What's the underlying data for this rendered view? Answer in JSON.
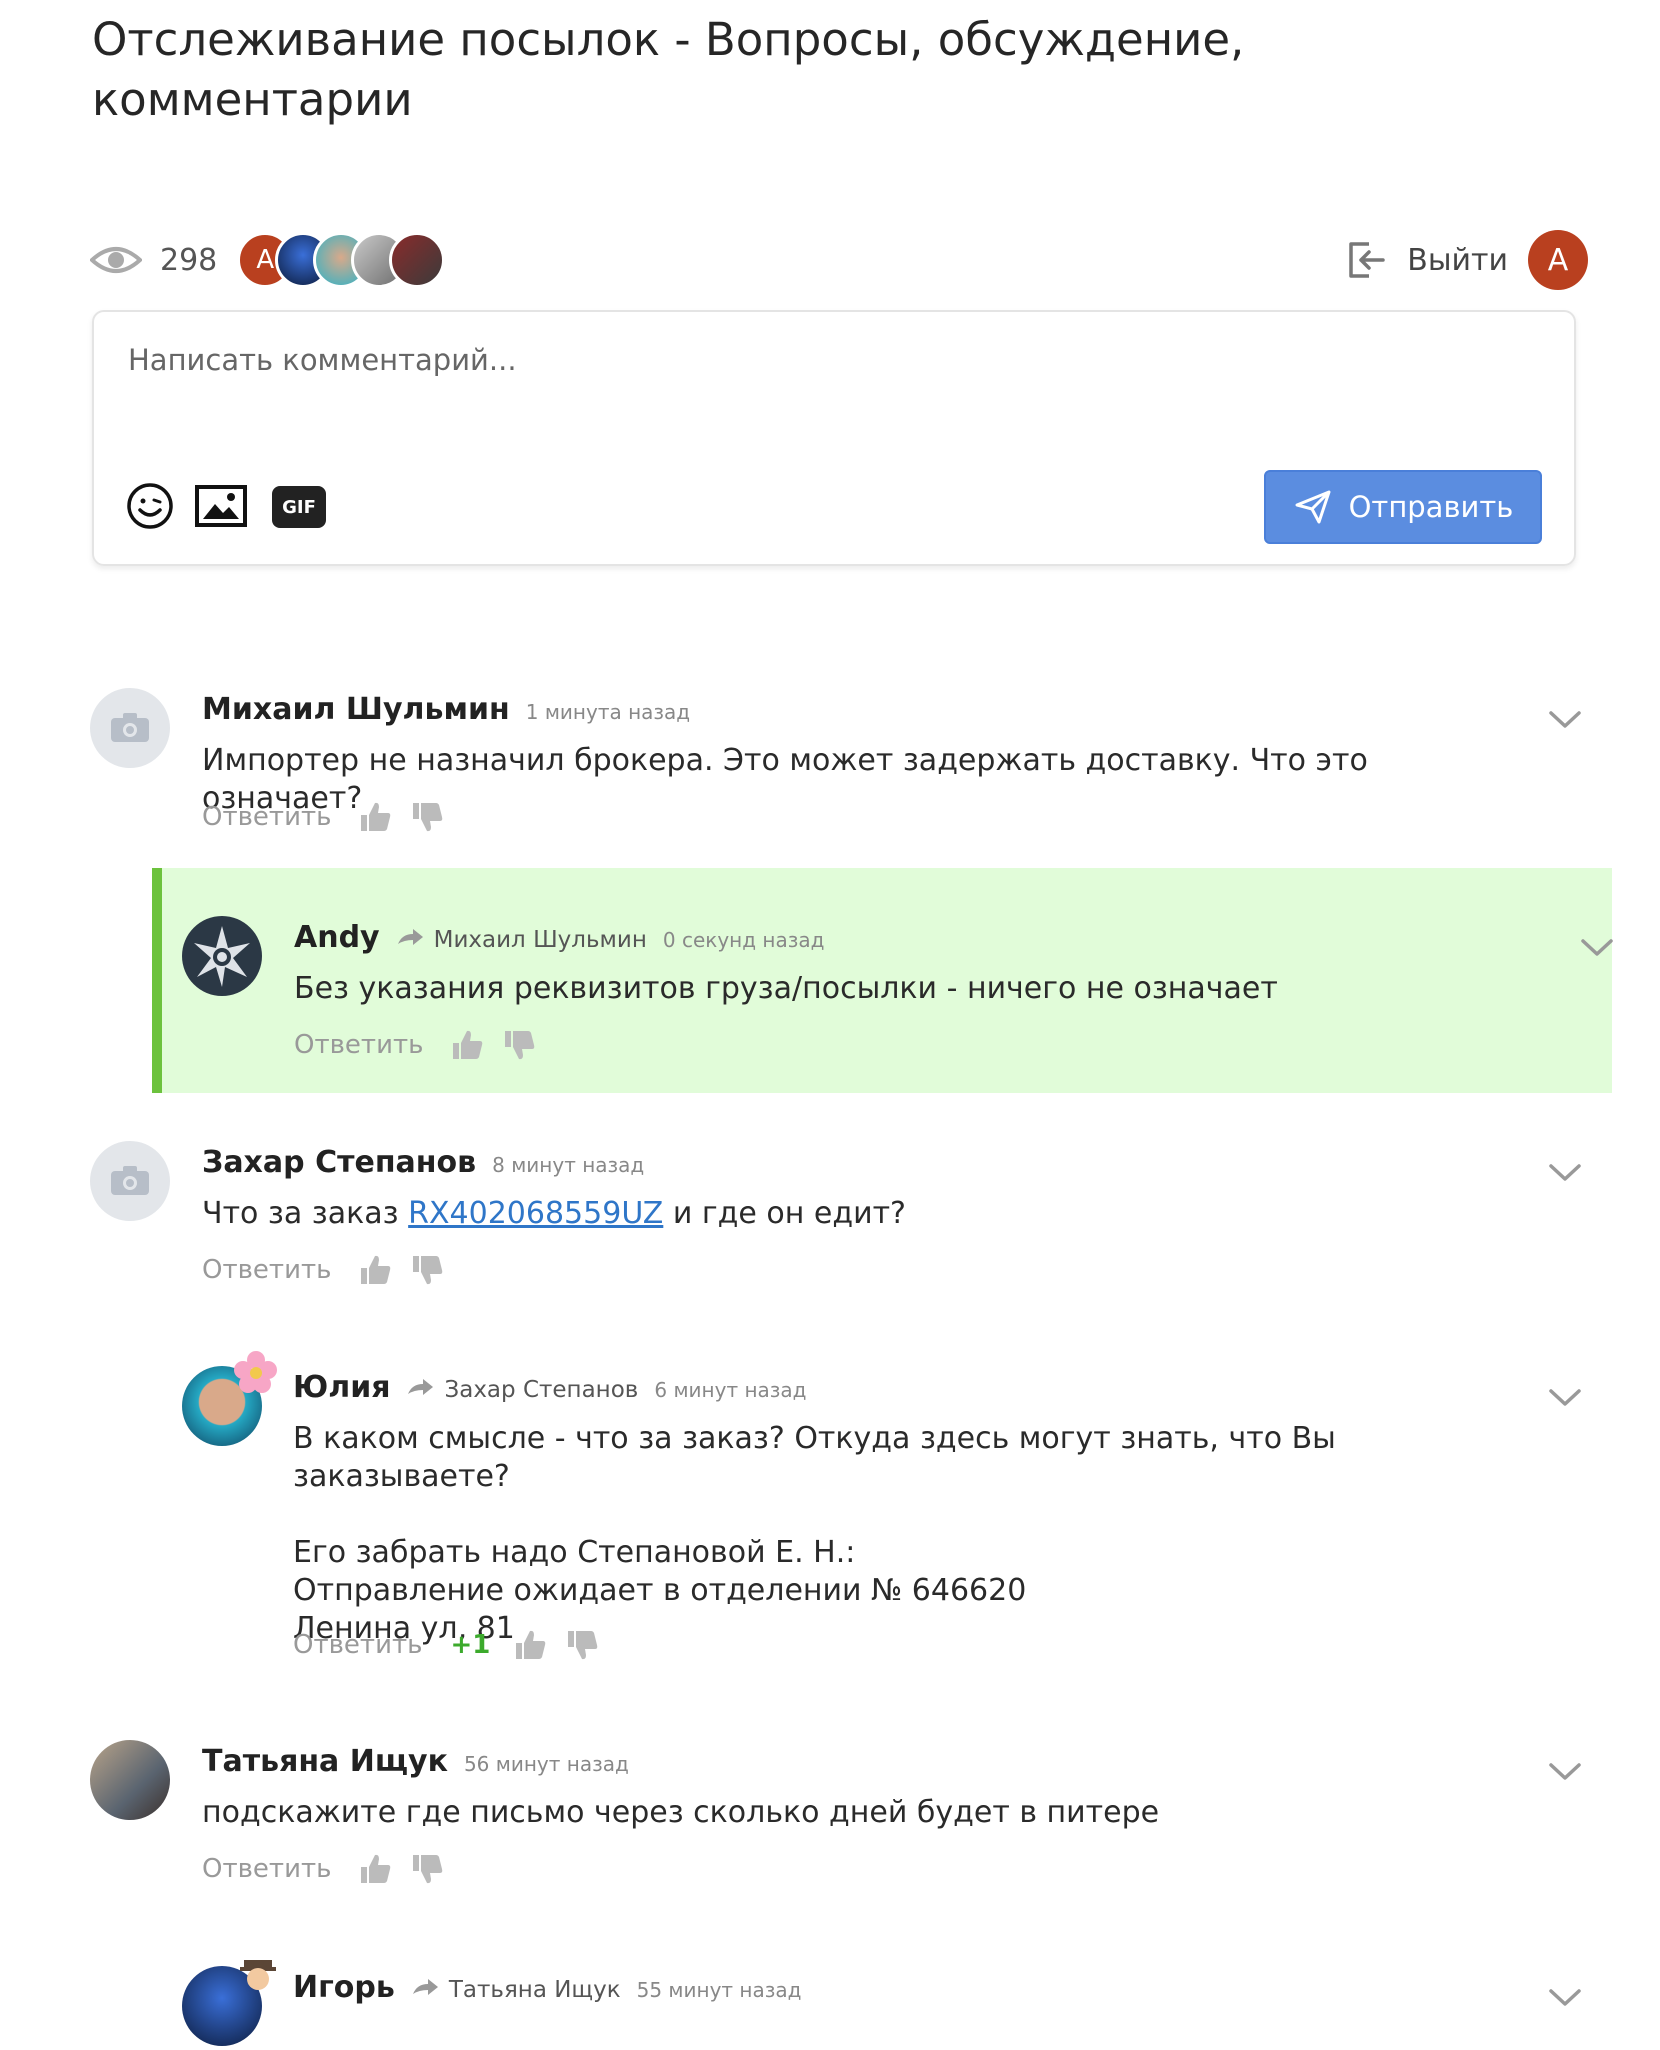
{
  "page": {
    "title": "Отслеживание посылок - Вопросы, обсуждение, комментарии"
  },
  "stats": {
    "views": "298",
    "user_initial": "A"
  },
  "header": {
    "logout_label": "Выйти",
    "user_initial": "A"
  },
  "composer": {
    "placeholder": "Написать комментарий...",
    "gif_label": "GIF",
    "send_label": "Отправить"
  },
  "comments": [
    {
      "author": "Михаил Шульмин",
      "time": "1 минута назад",
      "text": "Импортер не назначил брокера. Это может задержать доставку. Что это означает?",
      "reply_label": "Ответить"
    },
    {
      "author": "Andy",
      "reply_to": "Михаил Шульмин",
      "time": "0 секунд назад",
      "text": "Без указания реквизитов груза/посылки - ничего не означает",
      "reply_label": "Ответить"
    },
    {
      "author": "Захар Степанов",
      "time": "8 минут назад",
      "text_before": "Что за заказ ",
      "link": "RX402068559UZ",
      "text_after": " и где он едит?",
      "reply_label": "Ответить"
    },
    {
      "author": "Юлия",
      "reply_to": "Захар Степанов",
      "time": "6 минут назад",
      "text": "В каком смысле - что за заказ? Откуда здесь могут знать, что Вы заказываете?\n\nЕго забрать надо Степановой Е. Н.:\nОтправление ожидает в отделении № 646620\nЛенина ул, 81",
      "reply_label": "Ответить",
      "score": "+1"
    },
    {
      "author": "Татьяна Ищук",
      "time": "56 минут назад",
      "text": "подскажите где письмо через сколько дней будет в питере",
      "reply_label": "Ответить"
    },
    {
      "author": "Игорь",
      "reply_to": "Татьяна Ищук",
      "time": "55 минут назад"
    }
  ],
  "colors": {
    "accent": "#5b8de0",
    "highlight_bg": "#e1fcd9",
    "highlight_bar": "#6cc23d",
    "score": "#3caa2c",
    "link": "#2f76c8"
  }
}
